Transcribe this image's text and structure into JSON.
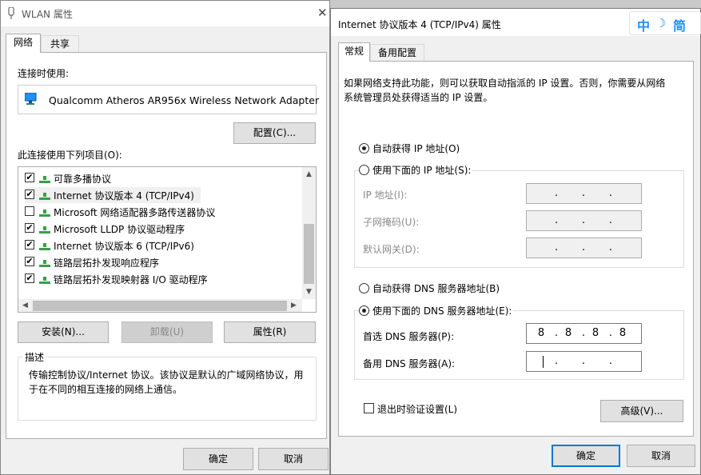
{
  "wlan_window": {
    "title": "WLAN 属性",
    "tabs": [
      "网络",
      "共享"
    ],
    "connect_using_label": "连接时使用:",
    "adapter_name": "Qualcomm Atheros AR956x Wireless Network Adapter",
    "configure_button": "配置(C)...",
    "items_label": "此连接使用下列项目(O):",
    "items": [
      {
        "label": "可靠多播协议",
        "checked": true
      },
      {
        "label": "Internet 协议版本 4 (TCP/IPv4)",
        "checked": true
      },
      {
        "label": "Microsoft 网络适配器多路传送器协议",
        "checked": false
      },
      {
        "label": "Microsoft LLDP 协议驱动程序",
        "checked": true
      },
      {
        "label": "Internet 协议版本 6 (TCP/IPv6)",
        "checked": true
      },
      {
        "label": "链路层拓扑发现响应程序",
        "checked": true
      },
      {
        "label": "链路层拓扑发现映射器 I/O 驱动程序",
        "checked": true
      }
    ],
    "install_button": "安装(N)...",
    "uninstall_button": "卸载(U)",
    "properties_button": "属性(R)",
    "description_label": "描述",
    "description_text": "传输控制协议/Internet 协议。该协议是默认的广域网络协议，用于在不同的相互连接的网络上通信。",
    "ok_button": "确定",
    "cancel_button": "取消"
  },
  "ipv4_window": {
    "title": "Internet 协议版本 4 (TCP/IPv4) 属性",
    "tabs": [
      "常规",
      "备用配置"
    ],
    "intro_text": "如果网络支持此功能，则可以获取自动指派的 IP 设置。否则，你需要从网络系统管理员处获得适当的 IP 设置。",
    "auto_ip_label": "自动获得 IP 地址(O)",
    "manual_ip_label": "使用下面的 IP 地址(S):",
    "ip_address_label": "IP 地址(I):",
    "subnet_label": "子网掩码(U):",
    "gateway_label": "默认网关(D):",
    "auto_dns_label": "自动获得 DNS 服务器地址(B)",
    "manual_dns_label": "使用下面的 DNS 服务器地址(E):",
    "preferred_dns_label": "首选 DNS 服务器(P):",
    "preferred_dns_octets": [
      "8",
      "8",
      "8",
      "8"
    ],
    "alternate_dns_label": "备用 DNS 服务器(A):",
    "validate_label": "退出时验证设置(L)",
    "advanced_button": "高级(V)...",
    "ok_button": "确定",
    "cancel_button": "取消"
  },
  "ime": {
    "mode": "中",
    "width": "简"
  },
  "colors": {
    "accent": "#0078d7",
    "adapter_icon": "#1e90ff"
  }
}
